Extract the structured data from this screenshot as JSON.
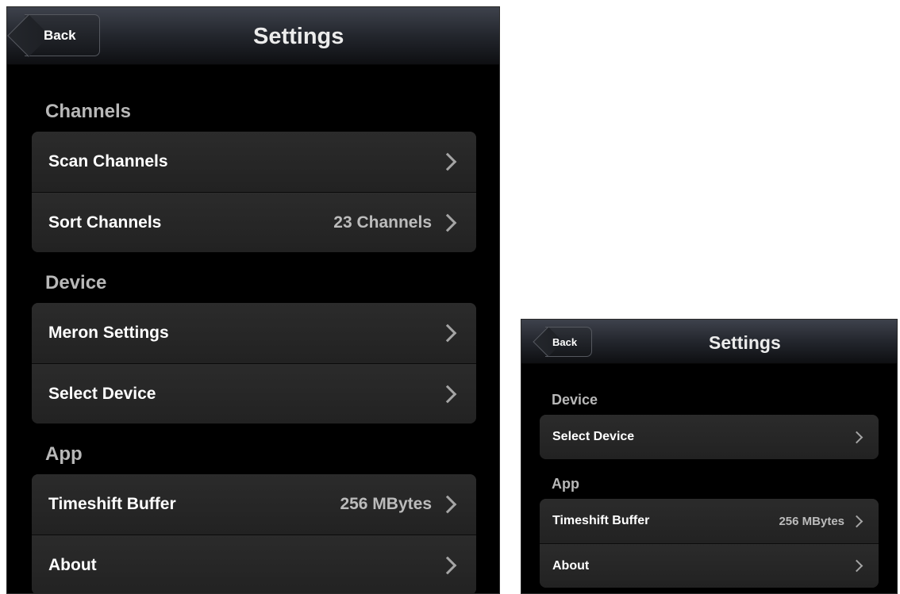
{
  "large_screen": {
    "back_label": "Back",
    "title": "Settings",
    "sections": [
      {
        "label": "Channels",
        "rows": [
          {
            "label": "Scan Channels",
            "value": ""
          },
          {
            "label": "Sort Channels",
            "value": "23 Channels"
          }
        ]
      },
      {
        "label": "Device",
        "rows": [
          {
            "label": "Meron Settings",
            "value": ""
          },
          {
            "label": "Select Device",
            "value": ""
          }
        ]
      },
      {
        "label": "App",
        "rows": [
          {
            "label": "Timeshift Buffer",
            "value": "256 MBytes"
          },
          {
            "label": "About",
            "value": ""
          }
        ]
      }
    ]
  },
  "small_screen": {
    "back_label": "Back",
    "title": "Settings",
    "sections": [
      {
        "label": "Device",
        "rows": [
          {
            "label": "Select Device",
            "value": ""
          }
        ]
      },
      {
        "label": "App",
        "rows": [
          {
            "label": "Timeshift Buffer",
            "value": "256 MBytes"
          },
          {
            "label": "About",
            "value": ""
          }
        ]
      }
    ]
  },
  "icons": {
    "row_chevron": "chevron-right-icon"
  },
  "colors": {
    "background": "#000000",
    "row": "#262626",
    "section_label": "#b8b8b8",
    "value_text": "#bcbcbc",
    "chevron": "#a5a5a5"
  }
}
